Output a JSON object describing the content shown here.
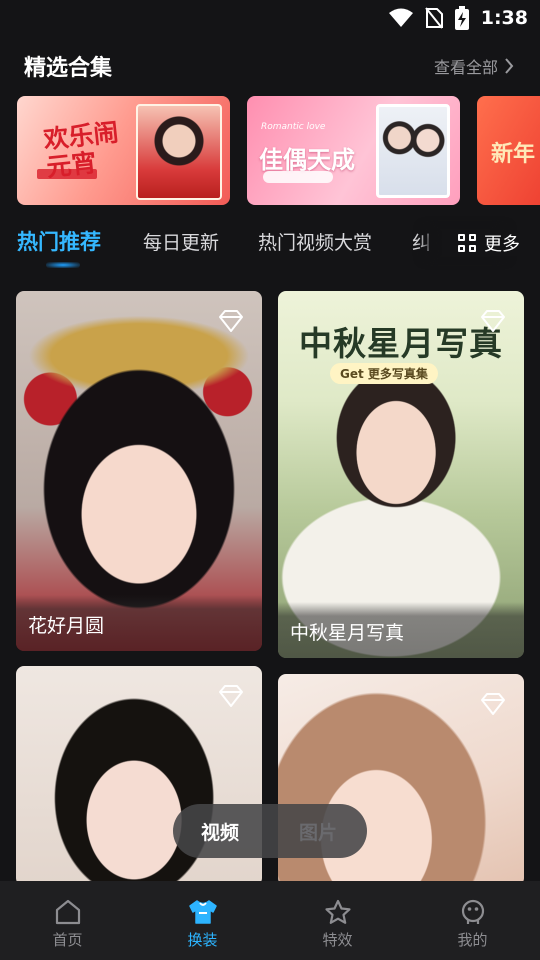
{
  "status_bar": {
    "time": "1:38",
    "icons": [
      "wifi-icon",
      "no-sim-icon",
      "battery-charging-icon"
    ]
  },
  "featured": {
    "title": "精选合集",
    "view_all": "查看全部",
    "collections": [
      {
        "text": "欢乐闹元宵"
      },
      {
        "text": "佳偶天成",
        "sub": "Romantic love"
      },
      {
        "text": "新年"
      }
    ]
  },
  "tabs": {
    "items": [
      "热门推荐",
      "每日更新",
      "热门视频大赏",
      "纠"
    ],
    "active": "热门推荐",
    "more": "更多"
  },
  "cards": [
    {
      "caption": "花好月圆"
    },
    {
      "caption": "中秋星月写真",
      "heading": "中秋星月写真",
      "sub": "Get 更多写真集"
    },
    {
      "caption": ""
    },
    {
      "caption": ""
    }
  ],
  "media_toggle": {
    "video": "视频",
    "image": "图片",
    "selected": "视频"
  },
  "bottom_nav": {
    "items": [
      {
        "label": "首页",
        "icon": "home-icon"
      },
      {
        "label": "换装",
        "icon": "shirt-icon"
      },
      {
        "label": "特效",
        "icon": "star-icon"
      },
      {
        "label": "我的",
        "icon": "profile-icon"
      }
    ],
    "active": "换装"
  },
  "colors": {
    "accent": "#2db4ff",
    "background": "#141416",
    "nav_background": "#1f1f21"
  }
}
